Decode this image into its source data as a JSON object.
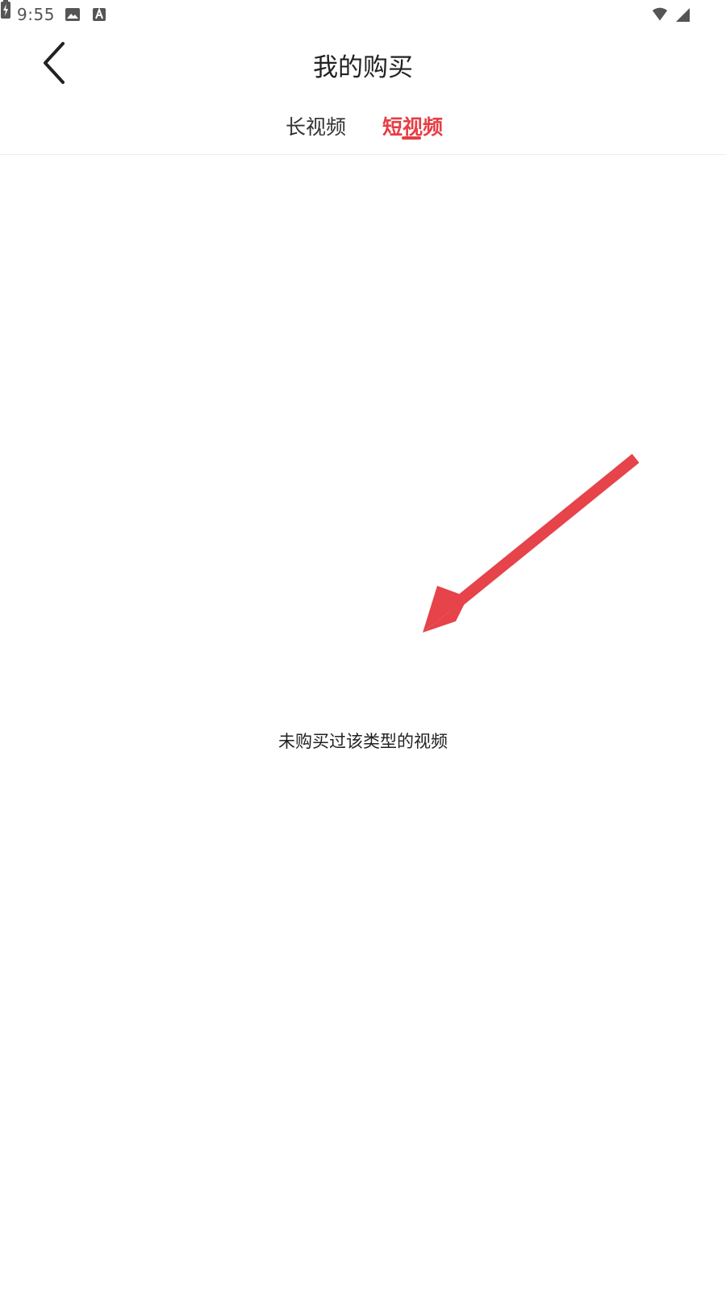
{
  "status_bar": {
    "time": "9:55",
    "icons": [
      "image-icon",
      "a-icon",
      "wifi-icon",
      "signal-icon",
      "battery-icon"
    ]
  },
  "header": {
    "title": "我的购买",
    "back_icon": "chevron-left-icon"
  },
  "tabs": [
    {
      "label": "长视频",
      "active": false
    },
    {
      "label": "短视频",
      "active": true
    }
  ],
  "content": {
    "empty_message": "未购买过该类型的视频"
  },
  "colors": {
    "accent": "#e63e44",
    "text": "#222222",
    "divider": "#ececec",
    "background": "#ffffff"
  }
}
